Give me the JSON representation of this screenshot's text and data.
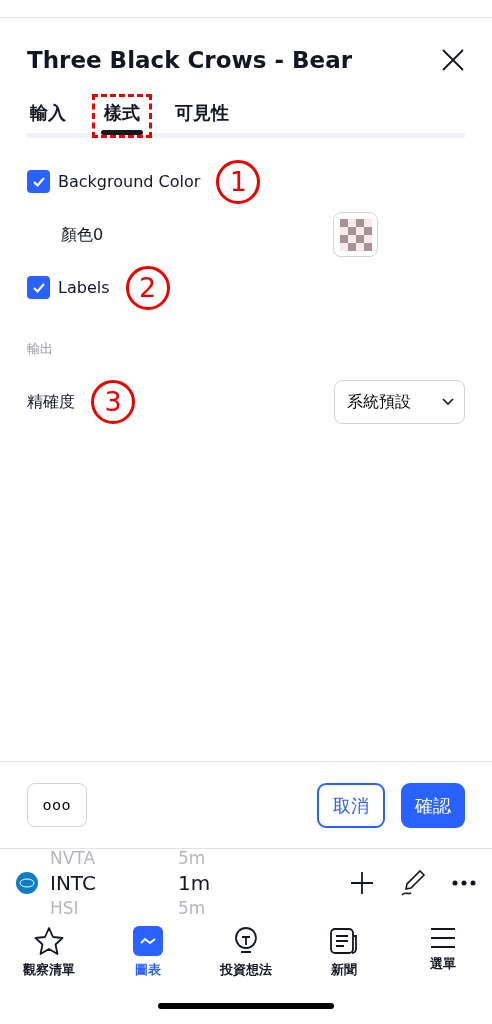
{
  "dialog": {
    "title": "Three Black Crows - Bear"
  },
  "tabs": [
    {
      "label": "輸入",
      "selected": false,
      "highlighted": false
    },
    {
      "label": "樣式",
      "selected": true,
      "highlighted": true
    },
    {
      "label": "可見性",
      "selected": false,
      "highlighted": false
    }
  ],
  "settings": [
    {
      "kind": "checkbox",
      "label": "Background Color",
      "checked": true,
      "marker": "1"
    },
    {
      "kind": "color",
      "label": "顏色0"
    },
    {
      "kind": "checkbox",
      "label": "Labels",
      "checked": true,
      "marker": "2"
    },
    {
      "kind": "section",
      "label": "輸出"
    },
    {
      "kind": "select",
      "label": "精確度",
      "value": "系統預設",
      "marker": "3"
    }
  ],
  "footer": {
    "more": "ooo",
    "cancel": "取消",
    "confirm": "確認"
  },
  "symbol_bar": {
    "above": {
      "symbol": "NVTA",
      "interval": "5m"
    },
    "current": {
      "symbol": "INTC",
      "interval": "1m"
    },
    "below": {
      "symbol": "HSI",
      "interval": "5m"
    }
  },
  "bottom_nav": [
    {
      "label": "觀察清單",
      "selected": false
    },
    {
      "label": "圖表",
      "selected": true
    },
    {
      "label": "投資想法",
      "selected": false
    },
    {
      "label": "新聞",
      "selected": false
    },
    {
      "label": "選單",
      "selected": false
    }
  ]
}
